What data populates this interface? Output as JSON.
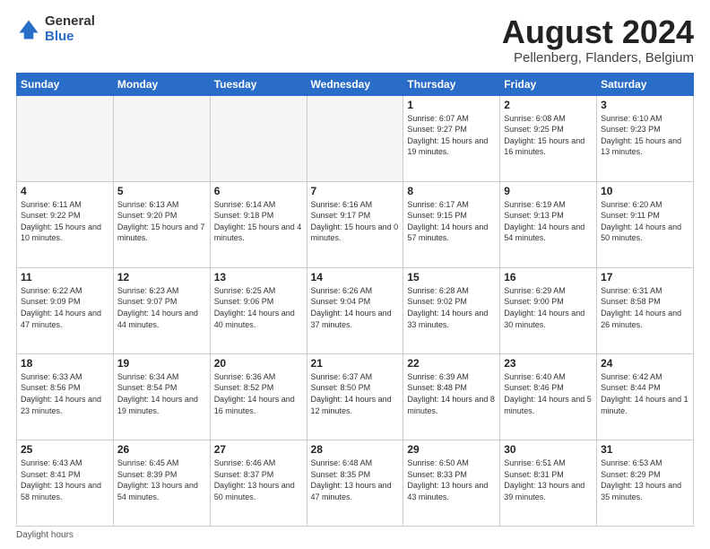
{
  "logo": {
    "general": "General",
    "blue": "Blue"
  },
  "header": {
    "title": "August 2024",
    "subtitle": "Pellenberg, Flanders, Belgium"
  },
  "days_of_week": [
    "Sunday",
    "Monday",
    "Tuesday",
    "Wednesday",
    "Thursday",
    "Friday",
    "Saturday"
  ],
  "weeks": [
    [
      {
        "day": "",
        "info": ""
      },
      {
        "day": "",
        "info": ""
      },
      {
        "day": "",
        "info": ""
      },
      {
        "day": "",
        "info": ""
      },
      {
        "day": "1",
        "info": "Sunrise: 6:07 AM\nSunset: 9:27 PM\nDaylight: 15 hours\nand 19 minutes."
      },
      {
        "day": "2",
        "info": "Sunrise: 6:08 AM\nSunset: 9:25 PM\nDaylight: 15 hours\nand 16 minutes."
      },
      {
        "day": "3",
        "info": "Sunrise: 6:10 AM\nSunset: 9:23 PM\nDaylight: 15 hours\nand 13 minutes."
      }
    ],
    [
      {
        "day": "4",
        "info": "Sunrise: 6:11 AM\nSunset: 9:22 PM\nDaylight: 15 hours\nand 10 minutes."
      },
      {
        "day": "5",
        "info": "Sunrise: 6:13 AM\nSunset: 9:20 PM\nDaylight: 15 hours\nand 7 minutes."
      },
      {
        "day": "6",
        "info": "Sunrise: 6:14 AM\nSunset: 9:18 PM\nDaylight: 15 hours\nand 4 minutes."
      },
      {
        "day": "7",
        "info": "Sunrise: 6:16 AM\nSunset: 9:17 PM\nDaylight: 15 hours\nand 0 minutes."
      },
      {
        "day": "8",
        "info": "Sunrise: 6:17 AM\nSunset: 9:15 PM\nDaylight: 14 hours\nand 57 minutes."
      },
      {
        "day": "9",
        "info": "Sunrise: 6:19 AM\nSunset: 9:13 PM\nDaylight: 14 hours\nand 54 minutes."
      },
      {
        "day": "10",
        "info": "Sunrise: 6:20 AM\nSunset: 9:11 PM\nDaylight: 14 hours\nand 50 minutes."
      }
    ],
    [
      {
        "day": "11",
        "info": "Sunrise: 6:22 AM\nSunset: 9:09 PM\nDaylight: 14 hours\nand 47 minutes."
      },
      {
        "day": "12",
        "info": "Sunrise: 6:23 AM\nSunset: 9:07 PM\nDaylight: 14 hours\nand 44 minutes."
      },
      {
        "day": "13",
        "info": "Sunrise: 6:25 AM\nSunset: 9:06 PM\nDaylight: 14 hours\nand 40 minutes."
      },
      {
        "day": "14",
        "info": "Sunrise: 6:26 AM\nSunset: 9:04 PM\nDaylight: 14 hours\nand 37 minutes."
      },
      {
        "day": "15",
        "info": "Sunrise: 6:28 AM\nSunset: 9:02 PM\nDaylight: 14 hours\nand 33 minutes."
      },
      {
        "day": "16",
        "info": "Sunrise: 6:29 AM\nSunset: 9:00 PM\nDaylight: 14 hours\nand 30 minutes."
      },
      {
        "day": "17",
        "info": "Sunrise: 6:31 AM\nSunset: 8:58 PM\nDaylight: 14 hours\nand 26 minutes."
      }
    ],
    [
      {
        "day": "18",
        "info": "Sunrise: 6:33 AM\nSunset: 8:56 PM\nDaylight: 14 hours\nand 23 minutes."
      },
      {
        "day": "19",
        "info": "Sunrise: 6:34 AM\nSunset: 8:54 PM\nDaylight: 14 hours\nand 19 minutes."
      },
      {
        "day": "20",
        "info": "Sunrise: 6:36 AM\nSunset: 8:52 PM\nDaylight: 14 hours\nand 16 minutes."
      },
      {
        "day": "21",
        "info": "Sunrise: 6:37 AM\nSunset: 8:50 PM\nDaylight: 14 hours\nand 12 minutes."
      },
      {
        "day": "22",
        "info": "Sunrise: 6:39 AM\nSunset: 8:48 PM\nDaylight: 14 hours\nand 8 minutes."
      },
      {
        "day": "23",
        "info": "Sunrise: 6:40 AM\nSunset: 8:46 PM\nDaylight: 14 hours\nand 5 minutes."
      },
      {
        "day": "24",
        "info": "Sunrise: 6:42 AM\nSunset: 8:44 PM\nDaylight: 14 hours\nand 1 minute."
      }
    ],
    [
      {
        "day": "25",
        "info": "Sunrise: 6:43 AM\nSunset: 8:41 PM\nDaylight: 13 hours\nand 58 minutes."
      },
      {
        "day": "26",
        "info": "Sunrise: 6:45 AM\nSunset: 8:39 PM\nDaylight: 13 hours\nand 54 minutes."
      },
      {
        "day": "27",
        "info": "Sunrise: 6:46 AM\nSunset: 8:37 PM\nDaylight: 13 hours\nand 50 minutes."
      },
      {
        "day": "28",
        "info": "Sunrise: 6:48 AM\nSunset: 8:35 PM\nDaylight: 13 hours\nand 47 minutes."
      },
      {
        "day": "29",
        "info": "Sunrise: 6:50 AM\nSunset: 8:33 PM\nDaylight: 13 hours\nand 43 minutes."
      },
      {
        "day": "30",
        "info": "Sunrise: 6:51 AM\nSunset: 8:31 PM\nDaylight: 13 hours\nand 39 minutes."
      },
      {
        "day": "31",
        "info": "Sunrise: 6:53 AM\nSunset: 8:29 PM\nDaylight: 13 hours\nand 35 minutes."
      }
    ]
  ],
  "footer": {
    "label": "Daylight hours"
  }
}
